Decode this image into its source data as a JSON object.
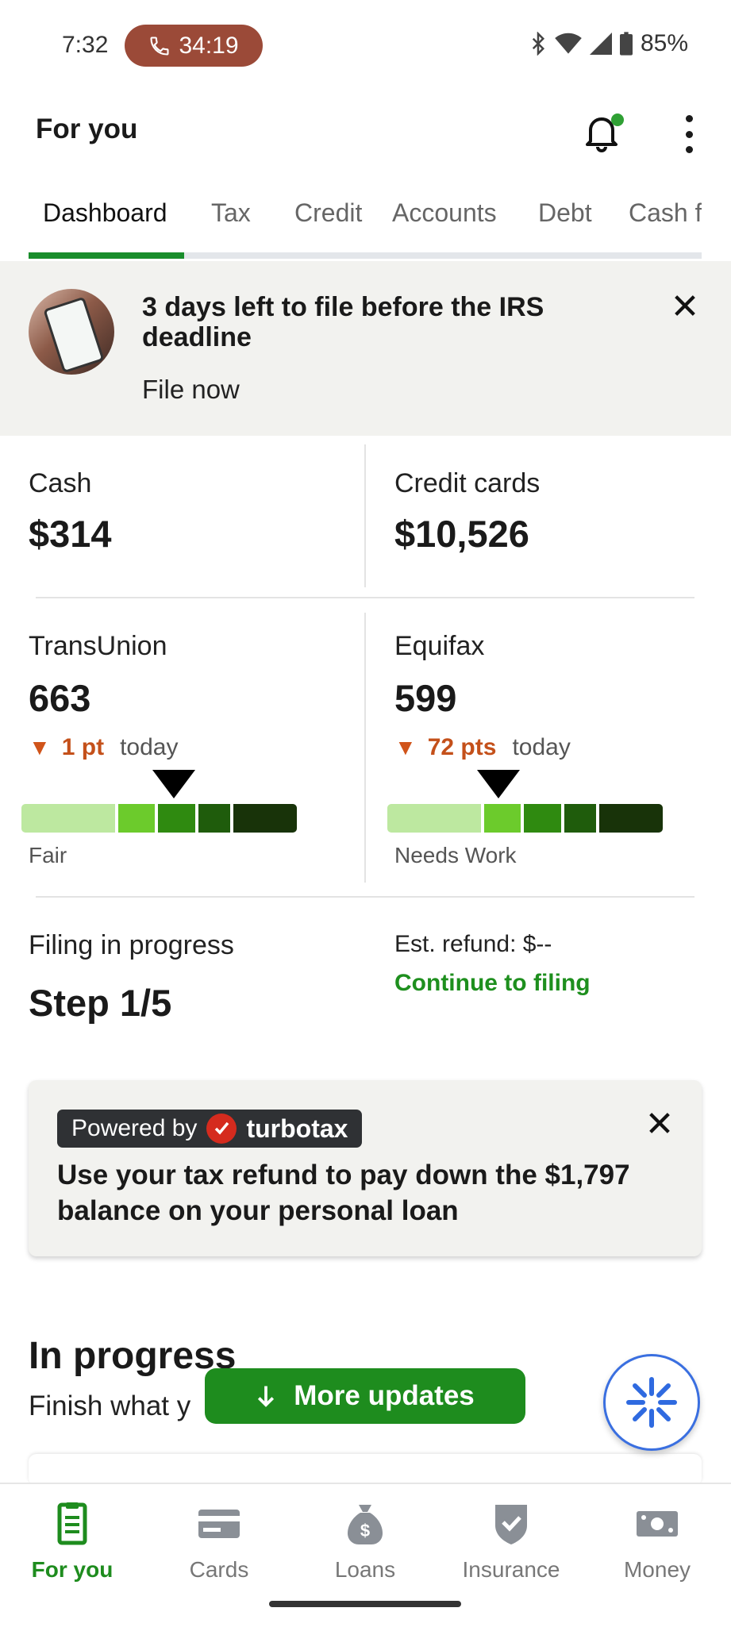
{
  "status_bar": {
    "time": "7:32",
    "call_timer": "34:19",
    "battery": "85%"
  },
  "header": {
    "title": "For you"
  },
  "tabs": [
    {
      "label": "Dashboard",
      "active": true
    },
    {
      "label": "Tax"
    },
    {
      "label": "Credit"
    },
    {
      "label": "Accounts"
    },
    {
      "label": "Debt"
    },
    {
      "label": "Cash f"
    }
  ],
  "banner": {
    "title": "3 days left to file before the IRS deadline",
    "link": "File now"
  },
  "balances": {
    "cash": {
      "label": "Cash",
      "value": "$314"
    },
    "credit_cards": {
      "label": "Credit cards",
      "value": "$10,526"
    }
  },
  "scores": {
    "transunion": {
      "label": "TransUnion",
      "score": "663",
      "delta": "1 pt",
      "when": "today",
      "rating": "Fair"
    },
    "equifax": {
      "label": "Equifax",
      "score": "599",
      "delta": "72 pts",
      "when": "today",
      "rating": "Needs Work"
    }
  },
  "filing": {
    "label": "Filing in progress",
    "step": "Step 1/5",
    "estimate": "Est. refund: $--",
    "action": "Continue to filing"
  },
  "promo": {
    "powered_by": "Powered by",
    "brand": "turbotax",
    "text": "Use your tax refund to pay down the $1,797 balance on your personal loan"
  },
  "in_progress": {
    "title": "In progress",
    "subtitle": "Finish what y"
  },
  "more_updates": "More updates",
  "bottom_nav": [
    {
      "label": "For you",
      "active": true,
      "icon": "document-icon"
    },
    {
      "label": "Cards",
      "icon": "credit-card-icon"
    },
    {
      "label": "Loans",
      "icon": "money-bag-icon"
    },
    {
      "label": "Insurance",
      "icon": "shield-check-icon"
    },
    {
      "label": "Money",
      "icon": "cash-icon"
    }
  ],
  "colors": {
    "brand_green": "#1e8c1e",
    "call_pill": "#9b4a38",
    "delta_orange": "#c4501a"
  }
}
